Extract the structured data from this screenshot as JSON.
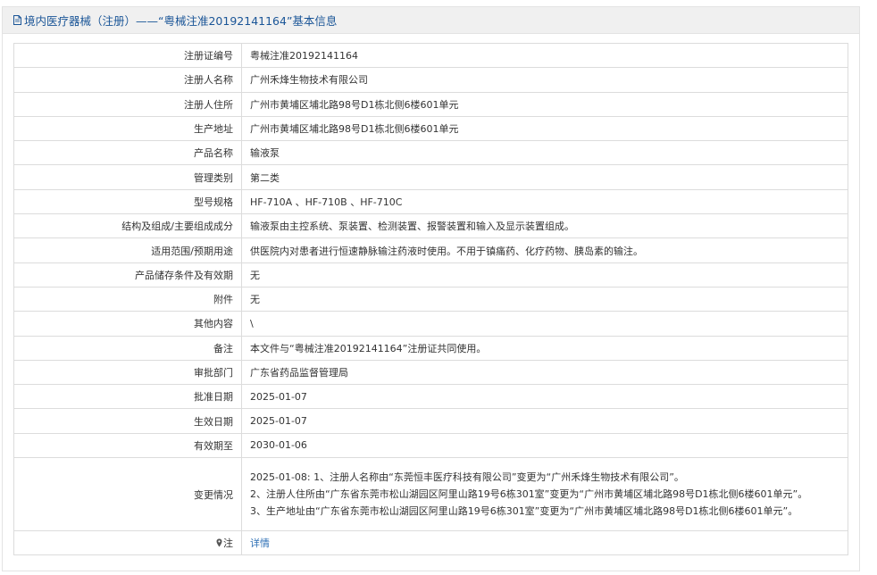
{
  "header": {
    "title": "境内医疗器械（注册）——“粤械注准20192141164”基本信息"
  },
  "rows": [
    {
      "label": "注册证编号",
      "value": "粤械注准20192141164"
    },
    {
      "label": "注册人名称",
      "value": "广州禾烽生物技术有限公司"
    },
    {
      "label": "注册人住所",
      "value": "广州市黄埔区埔北路98号D1栋北侧6楼601单元"
    },
    {
      "label": "生产地址",
      "value": "广州市黄埔区埔北路98号D1栋北侧6楼601单元"
    },
    {
      "label": "产品名称",
      "value": "输液泵"
    },
    {
      "label": "管理类别",
      "value": "第二类"
    },
    {
      "label": "型号规格",
      "value": "HF-710A 、HF-710B 、HF-710C"
    },
    {
      "label": "结构及组成/主要组成成分",
      "value": "输液泵由主控系统、泵装置、检测装置、报警装置和输入及显示装置组成。"
    },
    {
      "label": "适用范围/预期用途",
      "value": "供医院内对患者进行恒速静脉输注药液时使用。不用于镇痛药、化疗药物、胰岛素的输注。"
    },
    {
      "label": "产品储存条件及有效期",
      "value": "无"
    },
    {
      "label": "附件",
      "value": "无"
    },
    {
      "label": "其他内容",
      "value": "\\"
    },
    {
      "label": "备注",
      "value": "本文件与“粤械注准20192141164”注册证共同使用。"
    },
    {
      "label": "审批部门",
      "value": "广东省药品监督管理局"
    },
    {
      "label": "批准日期",
      "value": "2025-01-07"
    },
    {
      "label": "生效日期",
      "value": "2025-01-07"
    },
    {
      "label": "有效期至",
      "value": "2030-01-06"
    }
  ],
  "changes": {
    "label": "变更情况",
    "lines": [
      "2025-01-08: 1、注册人名称由“东莞恒丰医疗科技有限公司”变更为“广州禾烽生物技术有限公司”。",
      "2、注册人住所由“广东省东莞市松山湖园区阿里山路19号6栋301室”变更为“广州市黄埔区埔北路98号D1栋北侧6楼601单元”。",
      "3、生产地址由“广东省东莞市松山湖园区阿里山路19号6栋301室”变更为“广州市黄埔区埔北路98号D1栋北侧6楼601单元”。"
    ]
  },
  "note": {
    "label": "注",
    "link": "详情",
    "icon": "location-pin-icon"
  },
  "colors": {
    "header_bg": "#f0f0f0",
    "header_text": "#1a5597",
    "border": "#dcdcdc",
    "link": "#2d6fb5"
  }
}
